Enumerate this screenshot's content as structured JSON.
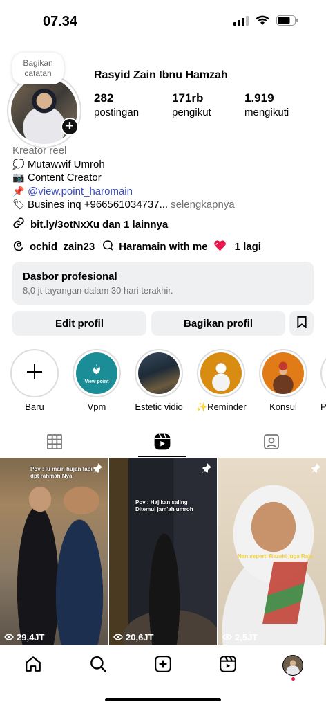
{
  "status_bar": {
    "time": "07.34"
  },
  "profile": {
    "note": "Bagikan catatan",
    "name": "Rasyid Zain Ibnu Hamzah",
    "stats": [
      {
        "value": "282",
        "label": "postingan"
      },
      {
        "value": "171rb",
        "label": "pengikut"
      },
      {
        "value": "1.919",
        "label": "mengikuti"
      }
    ]
  },
  "bio": {
    "category": "Kreator reel",
    "lines": [
      {
        "icon": "thought-balloon-icon",
        "text": "Mutawwif Umroh"
      },
      {
        "icon": "camera-icon",
        "text": "Content Creator"
      },
      {
        "icon": "pushpin-icon",
        "text": "@view.point_haromain"
      },
      {
        "icon": "label-icon",
        "text": "Busines inq +966561034737...",
        "more": "selengkapnya"
      }
    ],
    "link": "bit.ly/3otNxXu dan 1 lainnya",
    "threads_handle": "ochid_zain23",
    "community": "Haramain with me",
    "community_more": "1 lagi"
  },
  "dashboard": {
    "title": "Dasbor profesional",
    "subtitle": "8,0 jt tayangan dalam 30 hari terakhir."
  },
  "actions": {
    "edit": "Edit profil",
    "share": "Bagikan profil"
  },
  "highlights": [
    {
      "label": "Baru"
    },
    {
      "label": "Vpm",
      "inner_text": "View point"
    },
    {
      "label": "Estetic vidio"
    },
    {
      "label": "✨Reminder"
    },
    {
      "label": "Konsul"
    },
    {
      "label": "Po"
    }
  ],
  "tabs": [
    "grid",
    "reels",
    "tagged"
  ],
  "posts": [
    {
      "caption": "Pov : lu main hujan tapi dpt rahmah Nya",
      "views": "29,4JT"
    },
    {
      "caption": "Pov : Hajikan saling Ditemui jam'ah umroh",
      "views": "20,6JT"
    },
    {
      "caption": "Nan seperti Rezeki juga Raja",
      "views": "2,5JT"
    }
  ],
  "colors": {
    "link": "#3a4ec4",
    "secondary": "#737373",
    "button_bg": "#eff0f2",
    "notification": "#e8174b"
  }
}
